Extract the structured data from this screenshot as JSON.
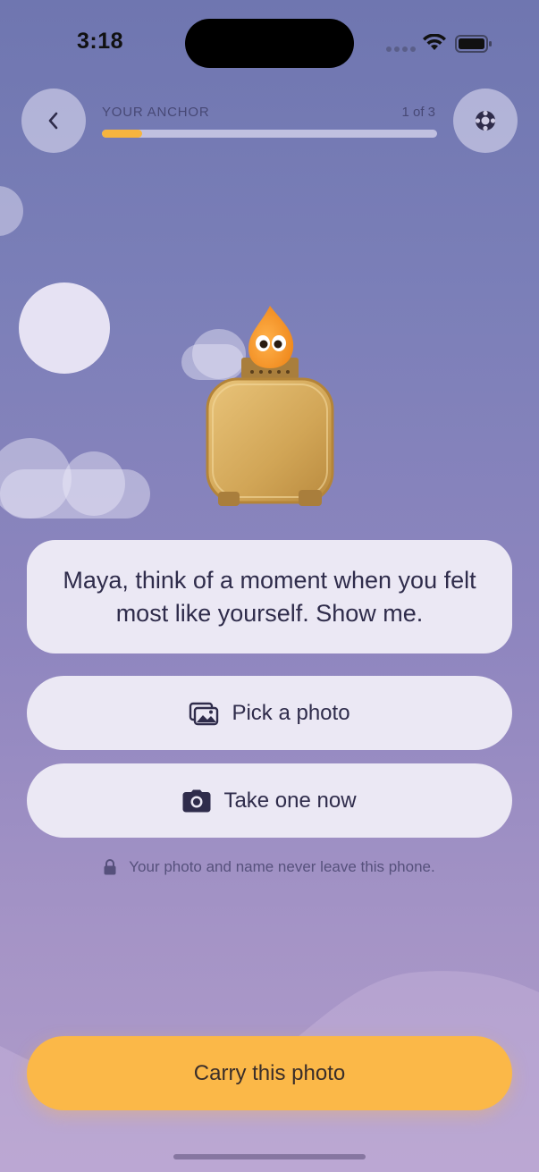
{
  "status_bar": {
    "time": "3:18"
  },
  "header": {
    "step_label": "YOUR ANCHOR",
    "step_count": "1 of 3",
    "progress_fraction": 0.12,
    "back_icon": "chevron-left-icon",
    "help_icon": "lifebuoy-icon"
  },
  "prompt": {
    "text": "Maya, think of a moment when you felt most like yourself. Show me."
  },
  "options": [
    {
      "label": "Pick a photo",
      "icon": "photo-gallery-icon"
    },
    {
      "label": "Take one now",
      "icon": "camera-icon"
    }
  ],
  "privacy_note": {
    "text": "Your photo and name never leave this phone.",
    "icon": "lock-icon"
  },
  "primary_action": {
    "label": "Carry this photo"
  },
  "colors": {
    "accent": "#fbb848",
    "progress": "#f6b43e",
    "card": "#ebe8f4",
    "text": "#2f2c4b"
  }
}
